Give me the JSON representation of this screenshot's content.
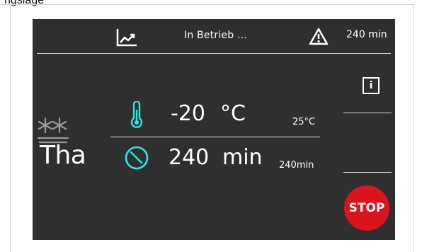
{
  "caption": "ngslage",
  "colors": {
    "screen_bg": "#2f2f2f",
    "accent": "#2ee6e6",
    "stop": "#d9141c",
    "text": "#ffffff"
  },
  "header": {
    "chart_icon": "trend-chart-icon",
    "status": "In Betrieb ...",
    "warning_icon": "warning-triangle-icon",
    "time_remaining": "240 min"
  },
  "sidebar": {
    "info_icon": "info-icon",
    "info_glyph": "i",
    "stop_label": "STOP"
  },
  "mode": {
    "icon": "snowflake-icon",
    "label": "Tha"
  },
  "temperature": {
    "icon": "thermometer-icon",
    "setpoint": "-20",
    "unit": "°C",
    "actual": "25°C"
  },
  "timer": {
    "icon": "clock-icon",
    "setpoint": "240",
    "unit": "min",
    "actual": "240min"
  }
}
